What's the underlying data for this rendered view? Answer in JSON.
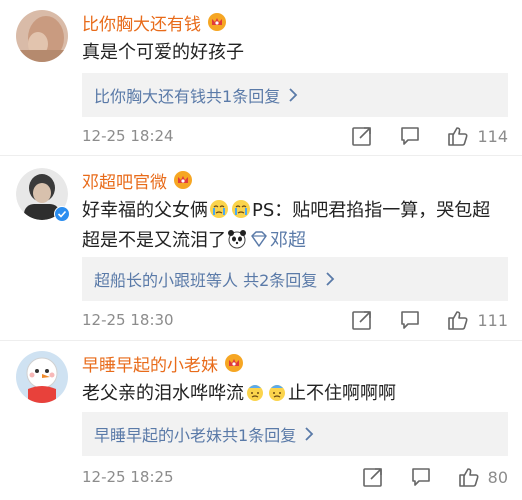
{
  "comments": [
    {
      "username": "比你胸大还有钱",
      "text": "真是个可爱的好孩子",
      "reply": {
        "link": "比你胸大还有钱",
        "suffix": " 共1条回复"
      },
      "timestamp": "12-25 18:24",
      "likes": "114"
    },
    {
      "username": "邓超吧官微",
      "text_part1": "好幸福的父女俩",
      "text_part2": "PS：贴吧君掐指一算，哭包超",
      "text_line2": "超是不是又流泪了",
      "mention": "邓超",
      "reply": {
        "link": "超船长的小跟班",
        "suffix": "等人 共2条回复"
      },
      "timestamp": "12-25 18:30",
      "likes": "111"
    },
    {
      "username": "早睡早起的小老妹",
      "text_part1": "老父亲的泪水哗哗流",
      "text_part2": "止不住啊啊啊",
      "reply": {
        "link": "早睡早起的小老妹",
        "suffix": " 共1条回复"
      },
      "timestamp": "12-25 18:25",
      "likes": "80"
    }
  ],
  "colors": {
    "username": "#e86b1a",
    "link": "#5a7aa8",
    "meta": "#8c8c8c",
    "reply_bg": "#f2f2f2"
  },
  "icons": [
    "vip-crown-icon",
    "share-icon",
    "comment-icon",
    "like-thumb-icon",
    "chevron-right-icon",
    "verified-badge-icon",
    "crying-face-emoji",
    "panda-emoji",
    "diamond-emoji",
    "sweat-face-emoji"
  ]
}
